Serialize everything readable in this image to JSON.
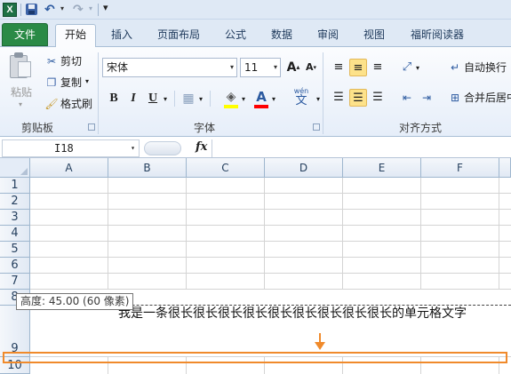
{
  "qat": {
    "app_icon": "X",
    "icons": [
      "excel-app-icon",
      "save-icon",
      "undo-icon",
      "redo-icon",
      "customize-icon"
    ]
  },
  "tabs": [
    {
      "label": "文件"
    },
    {
      "label": "开始"
    },
    {
      "label": "插入"
    },
    {
      "label": "页面布局"
    },
    {
      "label": "公式"
    },
    {
      "label": "数据"
    },
    {
      "label": "审阅"
    },
    {
      "label": "视图"
    },
    {
      "label": "福昕阅读器"
    }
  ],
  "clipboard": {
    "paste_label": "粘贴",
    "cut_label": "剪切",
    "copy_label": "复制",
    "format_painter_label": "格式刷",
    "group_label": "剪贴板"
  },
  "font": {
    "font_name": "宋体",
    "font_size": "11",
    "grow_label": "A",
    "shrink_label": "A",
    "bold_label": "B",
    "italic_label": "I",
    "underline_label": "U",
    "font_color_label": "A",
    "phonetic_label": "wén",
    "phonetic_char": "文",
    "group_label": "字体",
    "colors": {
      "highlight": "#ffff00",
      "font_color": "#ff0000"
    }
  },
  "alignment": {
    "wrap_label": "自动换行",
    "merge_label": "合并后居中",
    "group_label": "对齐方式"
  },
  "formula_bar": {
    "name_box": "I18",
    "fx_label": "fx",
    "formula": ""
  },
  "sheet": {
    "columns": [
      "A",
      "B",
      "C",
      "D",
      "E",
      "F"
    ],
    "rows": [
      "1",
      "2",
      "3",
      "4",
      "5",
      "6",
      "7",
      "8",
      "9",
      "10"
    ],
    "tooltip": "高度: 45.00 (60 像素)",
    "cell_text": "我是一条很长很长很长很长很长很长很长很长很长的单元格文字"
  },
  "colors": {
    "file_tab": "#2a8a46",
    "highlight_marker": "#f08a2b",
    "selected_button": "#fde28a"
  }
}
